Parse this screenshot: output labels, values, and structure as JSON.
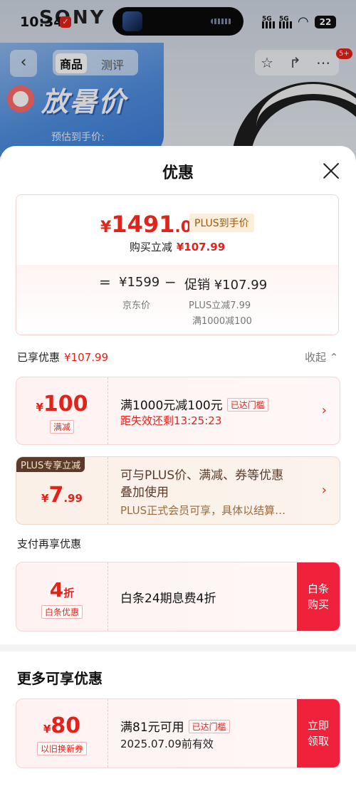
{
  "status_bar": {
    "time": "10:34",
    "sig1": "5G",
    "sig2": "5G",
    "battery": "22"
  },
  "background": {
    "brand": "SONY",
    "promo_text": "放暑价",
    "promo_sub": "预估到手价:"
  },
  "nav": {
    "tabs": [
      "商品",
      "测评"
    ],
    "badge_count": "5+"
  },
  "sheet": {
    "title": "优惠",
    "price_card": {
      "yen": "¥",
      "price_int": "1491",
      "price_dec": ".01",
      "plus_tag": "PLUS到手价",
      "discount_label": "购买立减",
      "discount_value": "¥107.99",
      "eq": "=",
      "minus": "−",
      "base_price": "¥1599",
      "base_label": "京东价",
      "promo_label": "促销",
      "promo_value": "¥107.99",
      "promo_line1": "PLUS立减7.99",
      "promo_line2": "满1000减100"
    },
    "enjoyed": {
      "label": "已享优惠",
      "value": "¥107.99",
      "collapse": "收起 ⌃"
    },
    "coupon_full": {
      "yen": "¥",
      "amount": "100",
      "type": "满减",
      "title": "满1000元减100元",
      "tag": "已达门槛",
      "sub": "距失效还剩13:25:23",
      "arrow": "›"
    },
    "coupon_plus": {
      "badge": "PLUS专享立减",
      "yen": "¥",
      "amount": "7",
      "decimal": ".99",
      "title_l1": "可与PLUS价、满减、券等优惠",
      "title_l2": "叠加使用",
      "sub": "PLUS正式会员可享，具体以结算…",
      "arrow": "›"
    },
    "pay_section": {
      "title": "支付再享优惠"
    },
    "coupon_baitiao": {
      "amount": "4",
      "unit": "折",
      "type": "白条优惠",
      "title": "白条24期息费4折",
      "button_l1": "白条",
      "button_l2": "购买"
    },
    "more_section": {
      "title": "更多可享优惠"
    },
    "coupon_tradein": {
      "yen": "¥",
      "amount": "80",
      "type": "以旧换新券",
      "title": "满81元可用",
      "tag": "已达门槛",
      "sub": "2025.07.09前有效",
      "button_l1": "立即",
      "button_l2": "领取"
    }
  },
  "colors": {
    "accent": "#e2231a",
    "button": "#f0213a",
    "plus_brown": "#5a3a2a"
  }
}
